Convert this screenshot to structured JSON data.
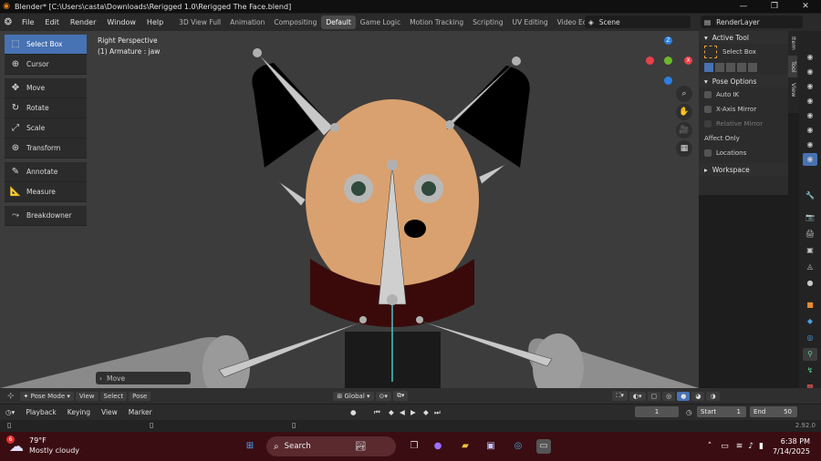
{
  "window": {
    "title": "Blender* [C:\\Users\\casta\\Downloads\\Rerigged 1.0\\Rerigged The Face.blend]",
    "minimize": "—",
    "maximize": "❐",
    "close": "✕"
  },
  "menu": [
    "File",
    "Edit",
    "Render",
    "Window",
    "Help"
  ],
  "workspaces": [
    "3D View Full",
    "Animation",
    "Compositing",
    "Default",
    "Game Logic",
    "Motion Tracking",
    "Scripting",
    "UV Editing",
    "Video Editing"
  ],
  "active_workspace": "Default",
  "scene": "Scene",
  "render_layer": "RenderLayer",
  "viewport": {
    "perspective": "Right Perspective",
    "object": "(1) Armature : jaw"
  },
  "tools": [
    {
      "label": "Select Box",
      "icon": "select-box-icon"
    },
    {
      "label": "Cursor",
      "icon": "cursor-icon"
    },
    {
      "label": "Move",
      "icon": "move-icon"
    },
    {
      "label": "Rotate",
      "icon": "rotate-icon"
    },
    {
      "label": "Scale",
      "icon": "scale-icon"
    },
    {
      "label": "Transform",
      "icon": "transform-icon"
    },
    {
      "label": "Annotate",
      "icon": "annotate-icon"
    },
    {
      "label": "Measure",
      "icon": "measure-icon"
    },
    {
      "label": "Breakdowner",
      "icon": "breakdowner-icon"
    }
  ],
  "last_operator": "Move",
  "sidebar": {
    "active_tool_header": "Active Tool",
    "active_tool_name": "Select Box",
    "pose_options_header": "Pose Options",
    "auto_ik": "Auto IK",
    "x_axis_mirror": "X-Axis Mirror",
    "relative_mirror": "Relative Mirror",
    "affect_only": "Affect Only",
    "locations": "Locations",
    "workspace_header": "Workspace",
    "tabs": [
      "Item",
      "Tool",
      "View"
    ],
    "active_tab": "Tool"
  },
  "gizmo": {
    "z": "Z",
    "x": "X"
  },
  "header": {
    "mode": "Pose Mode",
    "view": "View",
    "select": "Select",
    "pose": "Pose",
    "orientation": "Global"
  },
  "timeline": {
    "playback": "Playback",
    "keying": "Keying",
    "view": "View",
    "marker": "Marker",
    "current_frame": "1",
    "start_label": "Start",
    "start": "1",
    "end_label": "End",
    "end": "50"
  },
  "version": "2.92.0",
  "taskbar": {
    "temperature": "79°F",
    "weather": "Mostly cloudy",
    "weather_badge": "6",
    "search": "Search",
    "time": "6:38 PM",
    "date": "7/14/2025"
  },
  "colors": {
    "accent": "#4772b3",
    "x_axis": "#e8404c",
    "y_axis": "#6cb82b",
    "z_axis": "#2c7fe0",
    "taskbar": "#3a0d12"
  }
}
